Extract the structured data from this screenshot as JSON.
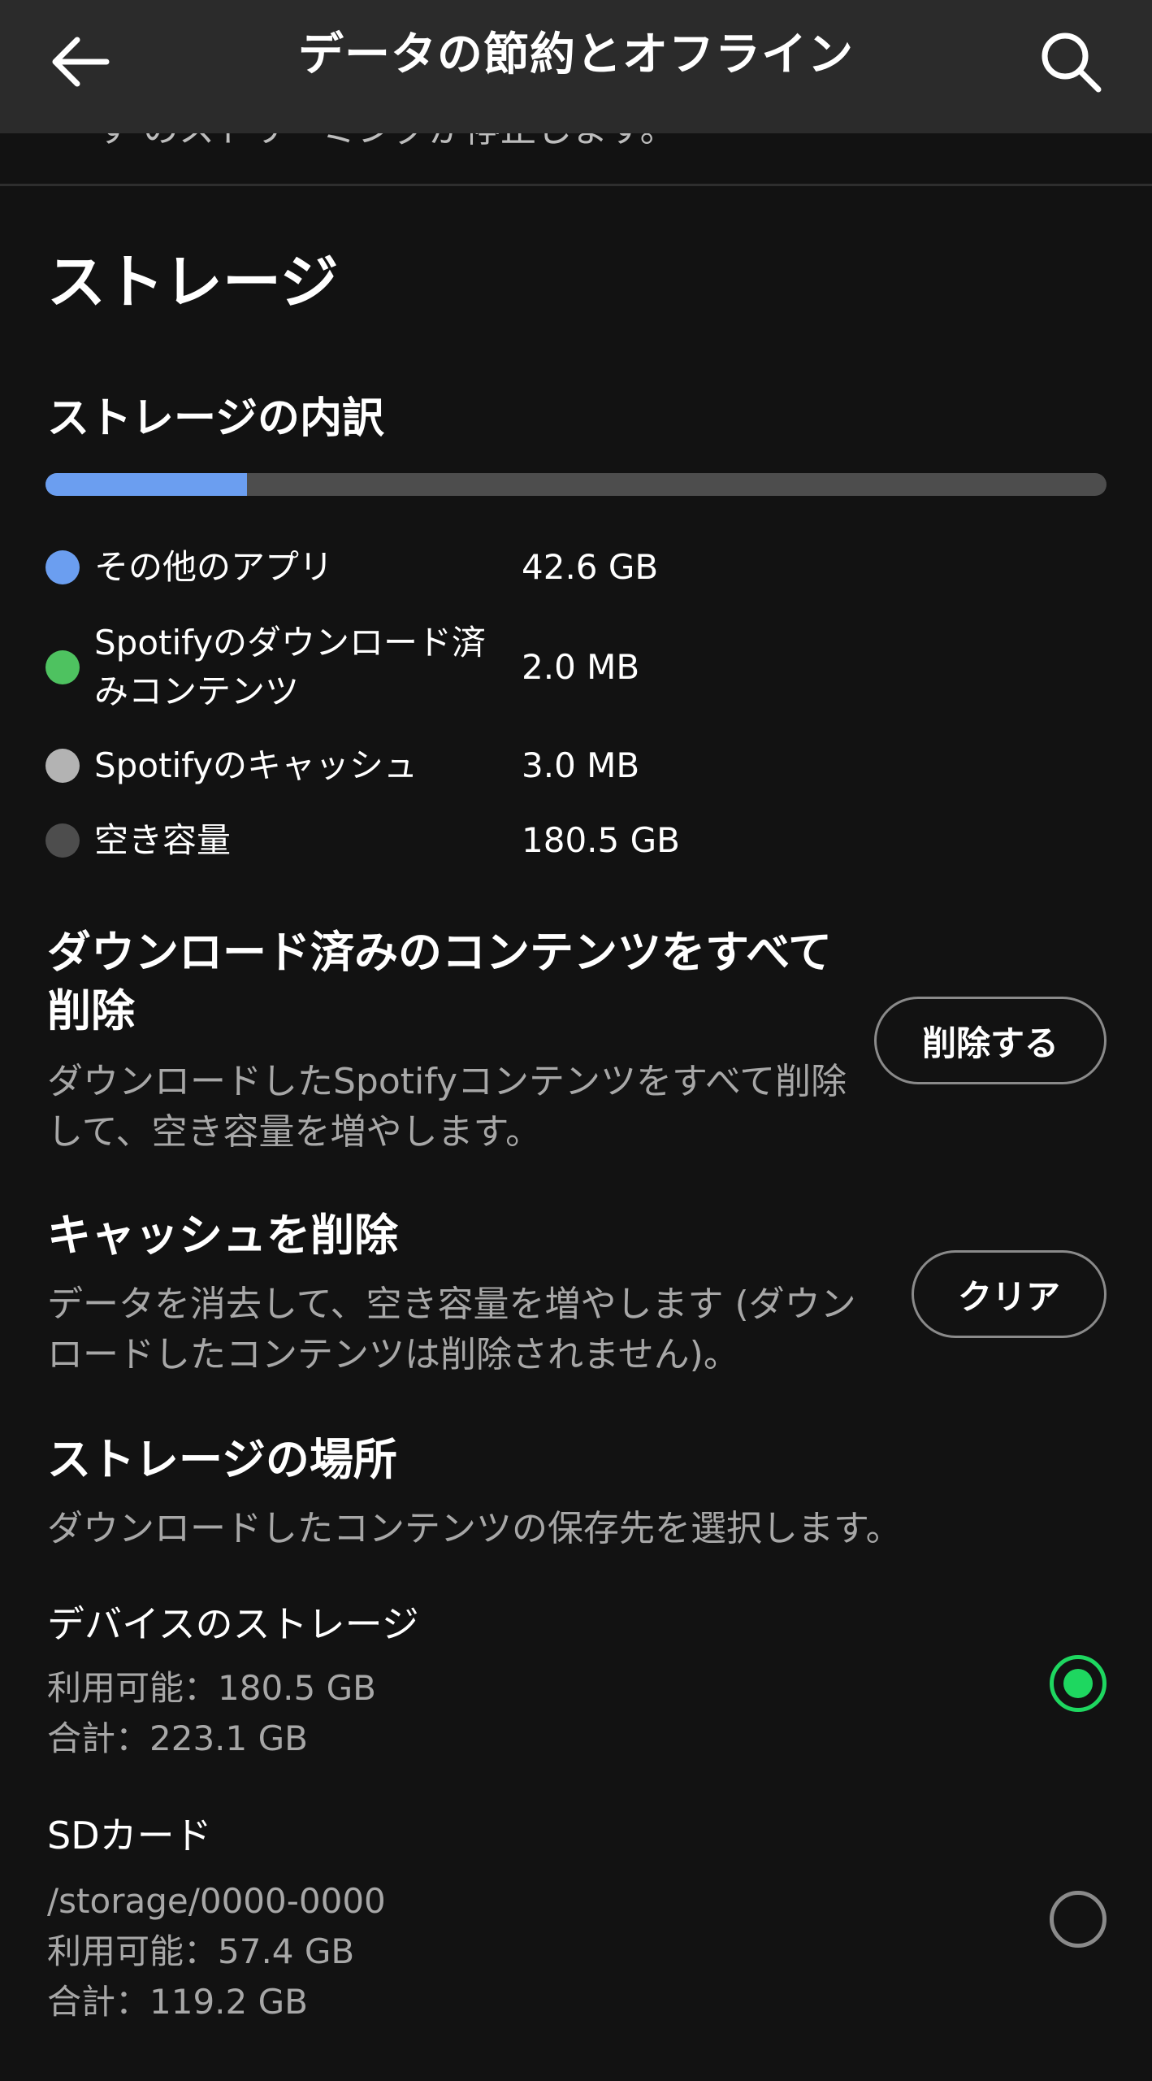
{
  "header": {
    "title": "データの節約とオフライン",
    "back_icon": "arrow-left-icon",
    "search_icon": "search-icon"
  },
  "scroll_cutoff_text": "ー す のストリーミングが停止します。",
  "storage": {
    "section_title": "ストレージ",
    "breakdown_title": "ストレージの内訳",
    "bar": {
      "used_fraction": 0.19,
      "fill_color": "#6b9ef0",
      "track_color": "#4d4d4d"
    },
    "legend": [
      {
        "label": "その他のアプリ",
        "value": "42.6 GB",
        "color": "#6b9ef0"
      },
      {
        "label": "Spotifyのダウンロード済みコンテンツ",
        "value": "2.0 MB",
        "color": "#4ec260"
      },
      {
        "label": "Spotifyのキャッシュ",
        "value": "3.0 MB",
        "color": "#b3b3b3"
      },
      {
        "label": "空き容量",
        "value": "180.5 GB",
        "color": "#4d4d4d"
      }
    ]
  },
  "delete_downloads": {
    "title": "ダウンロード済みのコンテンツをすべて削除",
    "description": "ダウンロードしたSpotifyコンテンツをすべて削除して、空き容量を増やします。",
    "button_label": "削除する"
  },
  "clear_cache": {
    "title": "キャッシュを削除",
    "description": "データを消去して、空き容量を増やします (ダウンロードしたコンテンツは削除されません)。",
    "button_label": "クリア"
  },
  "storage_location": {
    "title": "ストレージの場所",
    "description": "ダウンロードしたコンテンツの保存先を選択します。",
    "options": [
      {
        "name": "デバイスのストレージ",
        "path": "",
        "available": "利用可能：180.5 GB",
        "total": "合計：223.1 GB",
        "selected": true
      },
      {
        "name": "SDカード",
        "path": "/storage/0000-0000",
        "available": "利用可能：57.4 GB",
        "total": "合計：119.2 GB",
        "selected": false
      }
    ]
  },
  "colors": {
    "background": "#121212",
    "header": "#2b2b2b",
    "accent_green": "#1ed760",
    "secondary_text": "#a7a7a7"
  }
}
